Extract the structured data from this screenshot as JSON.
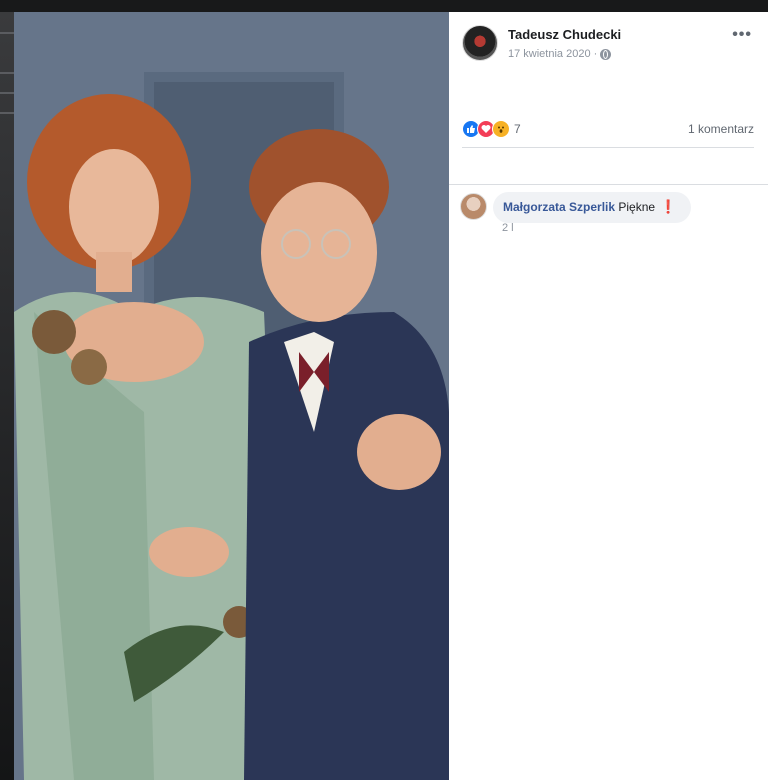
{
  "post": {
    "author": "Tadeusz Chudecki",
    "date": "17 kwietnia 2020",
    "more_label": "•••",
    "reactions": {
      "count": "7",
      "types": [
        "like-icon",
        "love-icon",
        "wow-icon"
      ]
    },
    "comment_count": "1 komentarz"
  },
  "comments": [
    {
      "author": "Małgorzata Szperlik",
      "text": "Piękne",
      "emoji": "❗",
      "time": "2 l"
    }
  ],
  "colors": {
    "link": "#385898",
    "like": "#1877f2",
    "love": "#f33e58",
    "wow": "#f7b125"
  }
}
